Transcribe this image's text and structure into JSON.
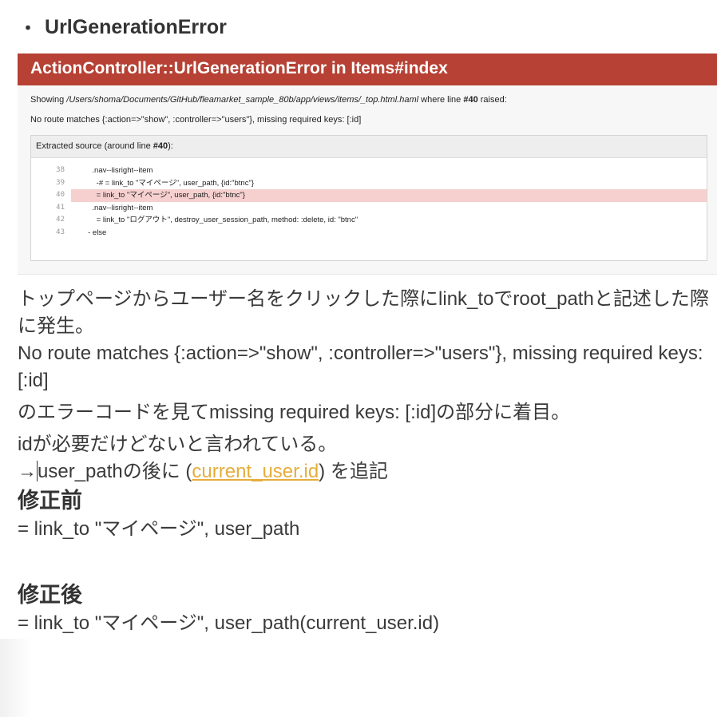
{
  "heading": {
    "bullet": "・",
    "text": "UrlGenerationError"
  },
  "error_screen": {
    "header_title": "ActionController::UrlGenerationError in Items#index",
    "showing_prefix": "Showing ",
    "showing_path": "/Users/shoma/Documents/GitHub/fleamarket_sample_80b/app/views/items/_top.html.haml",
    "showing_middle": " where line ",
    "showing_line": "#40",
    "showing_suffix": " raised:",
    "no_route": "No route matches {:action=>\"show\", :controller=>\"users\"}, missing required keys: [:id]",
    "source_title_prefix": "Extracted source (around line ",
    "source_title_line": "#40",
    "source_title_suffix": "):",
    "code_lines": [
      {
        "num": "38",
        "text": "          .nav--lisright--item"
      },
      {
        "num": "39",
        "text": "            -# = link_to \"マイページ\", user_path, {id:\"btnc\"}"
      },
      {
        "num": "40",
        "text": "            = link_to \"マイページ\", user_path, {id:\"btnc\"}"
      },
      {
        "num": "41",
        "text": "          .nav--lisright--item"
      },
      {
        "num": "42",
        "text": "            = link_to \"ログアウト\", destroy_user_session_path, method: :delete, id: \"btnc\""
      },
      {
        "num": "43",
        "text": "        - else"
      }
    ],
    "highlight_line": "40"
  },
  "notes": {
    "line1": "トップページからユーザー名をクリックした際にlink_toでroot_pathと記述した際に発生。",
    "line2": "No route matches {:action=>\"show\", :controller=>\"users\"}, missing required keys: [:id]",
    "line3": "のエラーコードを見てmissing required keys: [:id]の部分に着目。",
    "line4": "idが必要だけどないと言われている。",
    "line5_prefix": "→",
    "line5_mid": "user_pathの後に (",
    "line5_link": "current_user.id",
    "line5_suffix": ") を追記",
    "before_heading": "修正前",
    "before_code": "= link_to \"マイページ\", user_path",
    "after_heading": "修正後",
    "after_code": "= link_to \"マイページ\", user_path(current_user.id)"
  },
  "colors": {
    "error_header": "#b64134",
    "highlight_row": "#f6cfcf",
    "link": "#e6ad3c"
  }
}
